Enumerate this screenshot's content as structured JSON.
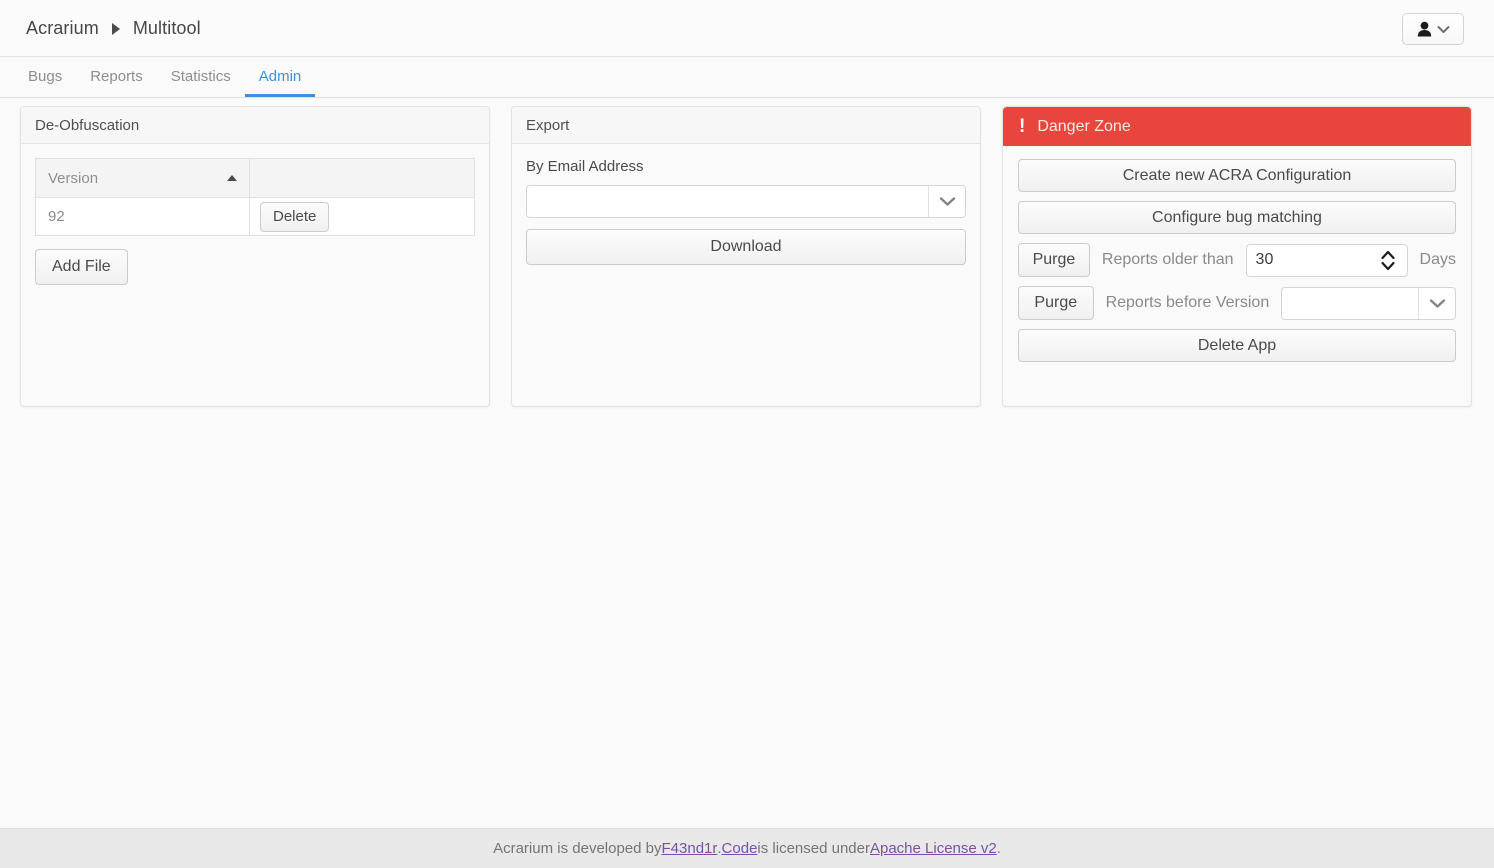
{
  "header": {
    "breadcrumb": [
      "Acrarium",
      "Multitool"
    ],
    "separator_icon": "triangle-right-icon",
    "user_menu": {
      "avatar_icon": "user-icon",
      "chevron_icon": "chevron-down-icon"
    }
  },
  "tabs": [
    {
      "label": "Bugs",
      "active": false
    },
    {
      "label": "Reports",
      "active": false
    },
    {
      "label": "Statistics",
      "active": false
    },
    {
      "label": "Admin",
      "active": true
    }
  ],
  "colors": {
    "accent": "#3f8fd9",
    "danger": "#e8453c",
    "page_bg": "#fafafa",
    "link": "#7e4f9e"
  },
  "deobfuscation": {
    "title": "De-Obfuscation",
    "table": {
      "columns": [
        "Version",
        ""
      ],
      "sort_icon": "sort-ascending-icon",
      "rows": [
        {
          "version": "92",
          "action_label": "Delete"
        }
      ]
    },
    "add_file_label": "Add File"
  },
  "export": {
    "title": "Export",
    "email_label": "By Email Address",
    "email_value": "",
    "email_placeholder": "",
    "email_chevron_icon": "chevron-down-icon",
    "download_label": "Download"
  },
  "danger_zone": {
    "title": "Danger Zone",
    "warning_icon": "exclamation-icon",
    "create_acra_label": "Create new ACRA Configuration",
    "configure_bug_matching_label": "Configure bug matching",
    "purge_age": {
      "button_label": "Purge",
      "label": "Reports older than",
      "value": "30",
      "unit": "Days",
      "spinner_icon": "spinner-up-down-icon"
    },
    "purge_version": {
      "button_label": "Purge",
      "label": "Reports before Version",
      "value": "",
      "placeholder": "",
      "chevron_icon": "chevron-down-icon"
    },
    "delete_app_label": "Delete App"
  },
  "footer": {
    "text_1": "Acrarium is developed by ",
    "link_1": "F43nd1r",
    "text_2": ". ",
    "link_2": "Code",
    "text_3": " is licensed under ",
    "link_3": "Apache License v2",
    "text_4": "."
  }
}
